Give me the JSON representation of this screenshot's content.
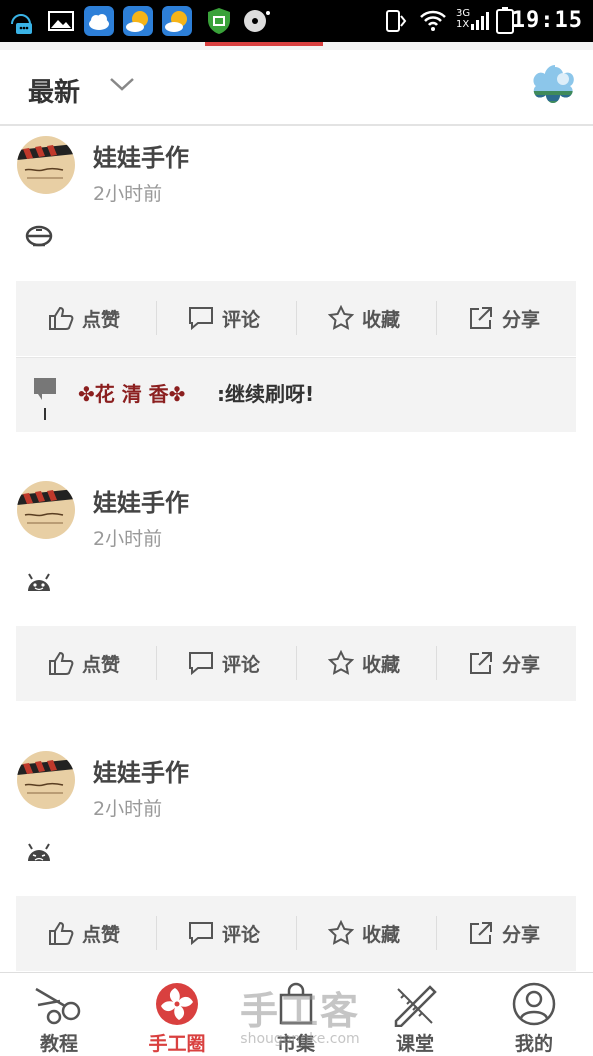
{
  "status_bar": {
    "time": "19:15",
    "network_top": "3G",
    "network_bottom": "1X"
  },
  "header": {
    "title": "最新"
  },
  "actions": {
    "like": "点赞",
    "comment": "评论",
    "favorite": "收藏",
    "share": "分享"
  },
  "posts": [
    {
      "author": "娃娃手作",
      "time": "2小时前",
      "emoji": "helmet-emoji",
      "comments": [
        {
          "user": "✤花 清 香✤",
          "text": ":继续刷呀!"
        }
      ]
    },
    {
      "author": "娃娃手作",
      "time": "2小时前",
      "emoji": "android-smile-emoji",
      "comments": []
    },
    {
      "author": "娃娃手作",
      "time": "2小时前",
      "emoji": "android-sad-emoji",
      "comments": []
    }
  ],
  "bottom_nav": [
    {
      "label": "教程",
      "icon": "scissors-icon",
      "active": false
    },
    {
      "label": "手工圈",
      "icon": "pinwheel-icon",
      "active": true
    },
    {
      "label": "市集",
      "icon": "shopping-bag-icon",
      "active": false
    },
    {
      "label": "课堂",
      "icon": "pencil-ruler-icon",
      "active": false
    },
    {
      "label": "我的",
      "icon": "user-icon",
      "active": false
    }
  ],
  "watermark": {
    "brand": "手工客",
    "site": "shougongke.com"
  },
  "colors": {
    "accent": "#d9403f",
    "action_bg": "#f3f3f3",
    "status_bar": "#000000",
    "comment_user": "#8b1f1f"
  }
}
